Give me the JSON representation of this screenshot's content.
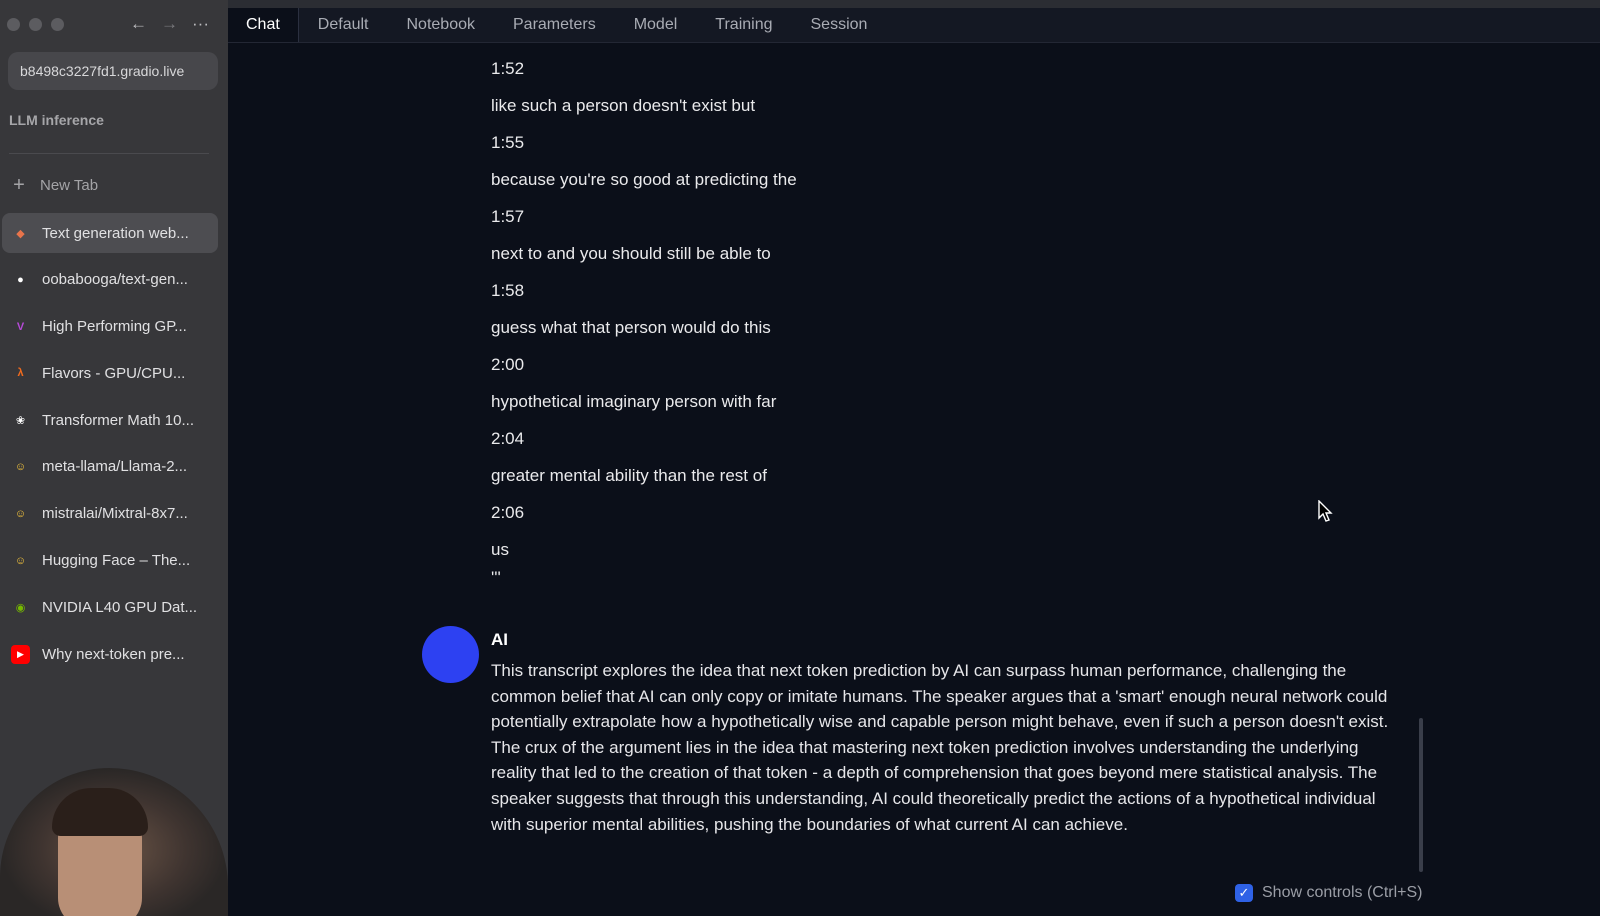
{
  "browser": {
    "url": "b8498c3227fd1.gradio.live",
    "section_title": "LLM inference",
    "new_tab_label": "New Tab",
    "tabs": [
      {
        "label": "Text generation web...",
        "icon": "layers-icon",
        "color": "#e8744b",
        "active": true
      },
      {
        "label": "oobabooga/text-gen...",
        "icon": "github-icon",
        "color": "#ffffff",
        "active": false
      },
      {
        "label": "High Performing GP...",
        "icon": "vast-icon",
        "color": "#b64ad8",
        "active": false
      },
      {
        "label": "Flavors - GPU/CPU...",
        "icon": "lambda-icon",
        "color": "#f26b1d",
        "active": false
      },
      {
        "label": "Transformer Math 10...",
        "icon": "openai-icon",
        "color": "#ffffff",
        "active": false
      },
      {
        "label": "meta-llama/Llama-2...",
        "icon": "huggingface-icon",
        "color": "#ffcc3d",
        "active": false
      },
      {
        "label": "mistralai/Mixtral-8x7...",
        "icon": "huggingface-icon",
        "color": "#ffcc3d",
        "active": false
      },
      {
        "label": "Hugging Face – The...",
        "icon": "huggingface-icon",
        "color": "#ffcc3d",
        "active": false
      },
      {
        "label": "NVIDIA L40 GPU Dat...",
        "icon": "nvidia-icon",
        "color": "#76b900",
        "active": false
      },
      {
        "label": "Why next-token pre...",
        "icon": "youtube-icon",
        "color": "#ff0000",
        "active": false
      }
    ]
  },
  "app": {
    "menu": [
      "Chat",
      "Default",
      "Notebook",
      "Parameters",
      "Model",
      "Training",
      "Session"
    ],
    "active_menu": "Chat",
    "transcript_lines": [
      "1:52",
      "like such a person doesn't exist but",
      "1:55",
      "because you're so good at predicting the",
      "1:57",
      "next to and you should still be able to",
      "1:58",
      "guess what that person would do this",
      "2:00",
      "hypothetical imaginary person with far",
      "2:04",
      "greater mental ability than the rest of",
      "2:06",
      "us"
    ],
    "transcript_end": "'''",
    "ai_message": {
      "name": "AI",
      "avatar_color": "#2d41f2",
      "text": "This transcript explores the idea that next token prediction by AI can surpass human performance, challenging the common belief that AI can only copy or imitate humans. The speaker argues that a 'smart' enough neural network could potentially extrapolate how a hypothetically wise and capable person might behave, even if such a person doesn't exist. The crux of the argument lies in the idea that mastering next token prediction involves understanding the underlying reality that led to the creation of that token - a depth of comprehension that goes beyond mere statistical analysis. The speaker suggests that through this understanding, AI could theoretically predict the actions of a hypothetical individual with superior mental abilities, pushing the boundaries of what current AI can achieve."
    },
    "show_controls_label": "Show controls (Ctrl+S)",
    "show_controls_checked": true
  }
}
